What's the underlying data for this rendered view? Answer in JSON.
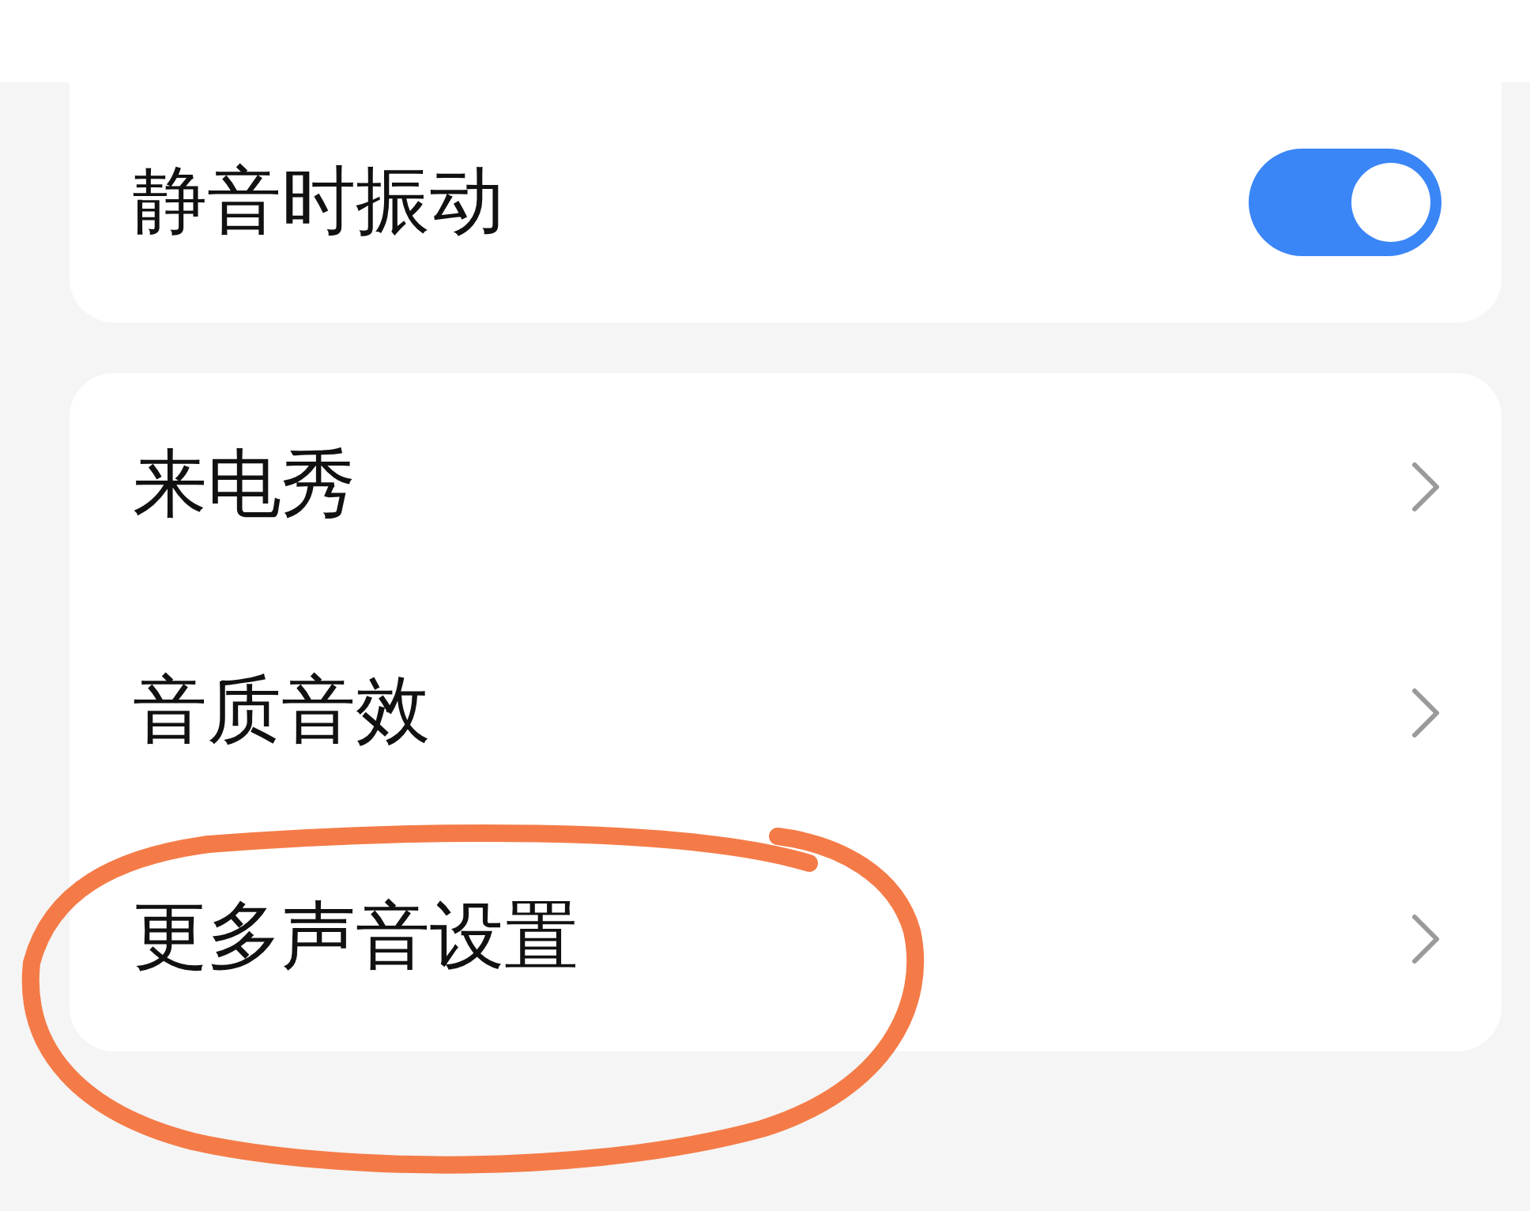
{
  "cards": [
    {
      "cut_top": true,
      "rows": [
        {
          "kind": "toggle",
          "label": "静音时振动",
          "on": true
        }
      ]
    },
    {
      "cut_top": false,
      "rows": [
        {
          "kind": "link",
          "label": "来电秀",
          "circled": false
        },
        {
          "kind": "link",
          "label": "音质音效",
          "circled": false
        },
        {
          "kind": "link",
          "label": "更多声音设置",
          "circled": true
        }
      ]
    }
  ]
}
